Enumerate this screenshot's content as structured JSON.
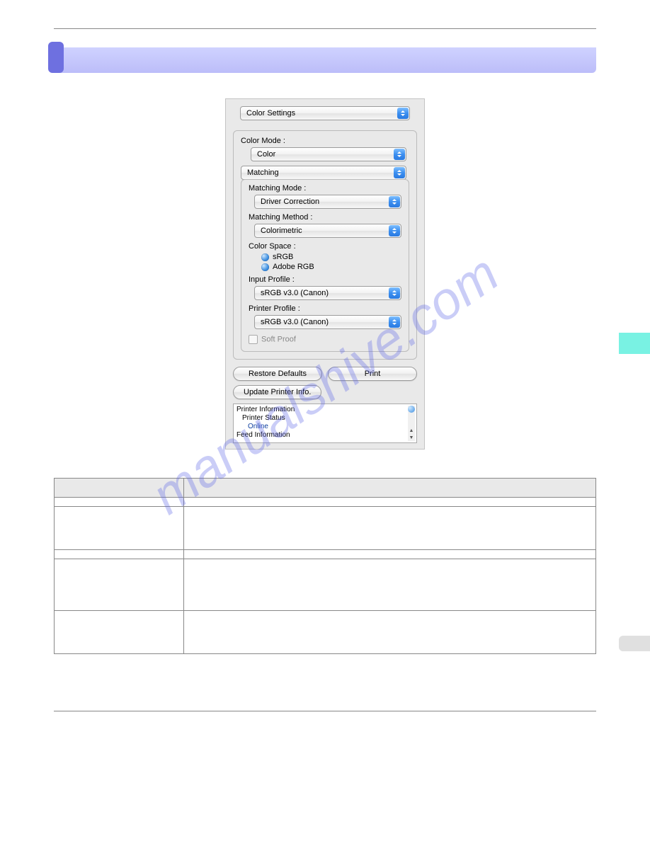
{
  "panel": {
    "top_select": "Color Settings",
    "color_mode_label": "Color Mode :",
    "color_mode_value": "Color",
    "sub_tab": "Matching",
    "matching_mode_label": "Matching Mode :",
    "matching_mode_value": "Driver Correction",
    "matching_method_label": "Matching Method :",
    "matching_method_value": "Colorimetric",
    "color_space_label": "Color Space :",
    "color_space_options": [
      "sRGB",
      "Adobe RGB"
    ],
    "input_profile_label": "Input Profile :",
    "input_profile_value": "sRGB v3.0 (Canon)",
    "printer_profile_label": "Printer Profile :",
    "printer_profile_value": "sRGB v3.0 (Canon)",
    "soft_proof_label": "Soft Proof",
    "restore_defaults": "Restore Defaults",
    "print": "Print",
    "update_printer_info": "Update Printer Info.",
    "info_lines": {
      "l1": "Printer Information",
      "l2": "Printer Status",
      "l3": "Online",
      "l4": "Feed Information"
    }
  },
  "watermark": "manualshive.com"
}
